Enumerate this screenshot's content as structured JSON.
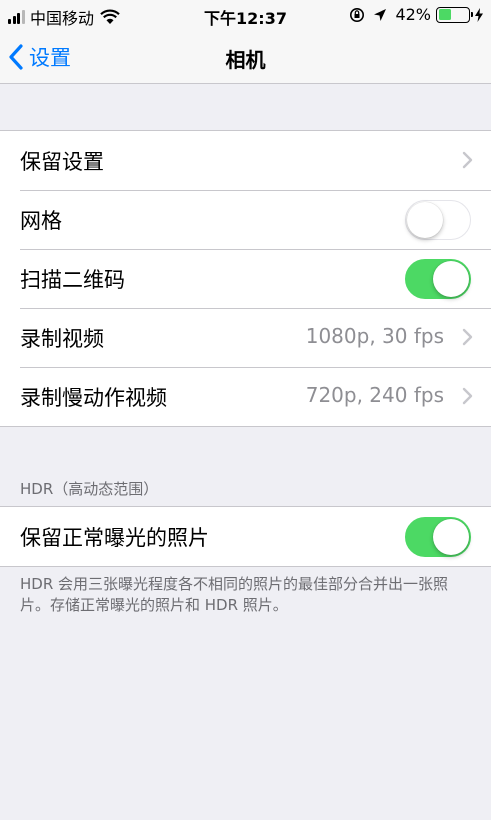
{
  "status_bar": {
    "carrier": "中国移动",
    "time": "下午12:37",
    "battery_percent": "42%",
    "battery_level": 0.42
  },
  "nav": {
    "back_label": "设置",
    "title": "相机"
  },
  "group1": {
    "rows": [
      {
        "label": "保留设置",
        "value": "",
        "control": "chevron"
      },
      {
        "label": "网格",
        "value": "",
        "control": "toggle",
        "on": false
      },
      {
        "label": "扫描二维码",
        "value": "",
        "control": "toggle",
        "on": true
      },
      {
        "label": "录制视频",
        "value": "1080p, 30 fps",
        "control": "chevron"
      },
      {
        "label": "录制慢动作视频",
        "value": "720p, 240 fps",
        "control": "chevron"
      }
    ]
  },
  "hdr_section": {
    "header": "HDR（高动态范围）",
    "row_label": "保留正常曝光的照片",
    "row_on": true,
    "footer": "HDR 会用三张曝光程度各不相同的照片的最佳部分合并出一张照片。存储正常曝光的照片和 HDR 照片。"
  },
  "colors": {
    "accent": "#007aff",
    "toggle_on": "#4cd964",
    "background": "#efeff4"
  }
}
